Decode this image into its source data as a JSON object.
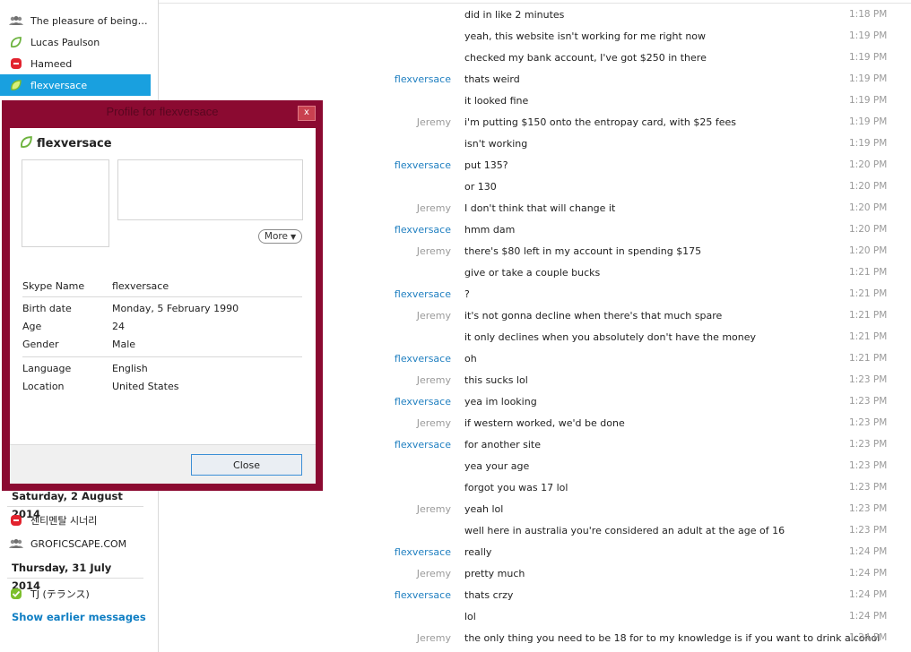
{
  "sidebar": {
    "contacts_top": [
      {
        "label": "The pleasure of being cu...",
        "icon": "group-icon"
      },
      {
        "label": "Lucas Paulson",
        "icon": "status-away-leaf-icon"
      },
      {
        "label": "Hameed",
        "icon": "status-offline-skype-icon"
      },
      {
        "label": "flexversace",
        "icon": "status-away-leaf-icon",
        "selected": true
      }
    ],
    "date_1": "Saturday, 2 August 2014",
    "contacts_mid": [
      {
        "label": "센티멘탈 시너리",
        "icon": "status-offline-skype-icon"
      },
      {
        "label": "GROFICSCAPE.COM",
        "icon": "group-icon"
      }
    ],
    "date_2": "Thursday, 31 July 2014",
    "contacts_bottom": [
      {
        "label": "TJ (テランス)",
        "icon": "status-online-check-icon"
      }
    ],
    "show_earlier": "Show earlier messages"
  },
  "dialog": {
    "title": "Profile for flexversace",
    "close_x": "x",
    "name": "flexversace",
    "more": "More",
    "fields": {
      "skype_name_label": "Skype Name",
      "skype_name": "flexversace",
      "birth_label": "Birth date",
      "birth": "Monday, 5 February 1990",
      "age_label": "Age",
      "age": "24",
      "gender_label": "Gender",
      "gender": "Male",
      "language_label": "Language",
      "language": "English",
      "location_label": "Location",
      "location": "United States"
    },
    "close_button": "Close"
  },
  "messages": [
    {
      "sender": "",
      "text": "did in like 2 minutes",
      "time": "1:18 PM"
    },
    {
      "sender": "",
      "text": "yeah, this website isn't working for me right now",
      "time": "1:19 PM"
    },
    {
      "sender": "",
      "text": "checked my bank account, I've got $250 in there",
      "time": "1:19 PM"
    },
    {
      "sender": "flexversace",
      "text": "thats weird",
      "time": "1:19 PM"
    },
    {
      "sender": "",
      "text": "it looked fine",
      "time": "1:19 PM"
    },
    {
      "sender": "Jeremy",
      "text": "i'm putting $150 onto the entropay card, with $25 fees",
      "time": "1:19 PM"
    },
    {
      "sender": "",
      "text": "isn't working",
      "time": "1:19 PM"
    },
    {
      "sender": "flexversace",
      "text": "put 135?",
      "time": "1:20 PM"
    },
    {
      "sender": "",
      "text": "or 130",
      "time": "1:20 PM"
    },
    {
      "sender": "Jeremy",
      "text": "I don't think that will change it",
      "time": "1:20 PM"
    },
    {
      "sender": "flexversace",
      "text": "hmm dam",
      "time": "1:20 PM"
    },
    {
      "sender": "Jeremy",
      "text": "there's $80 left in my account in spending $175",
      "time": "1:20 PM"
    },
    {
      "sender": "",
      "text": "give or take a couple bucks",
      "time": "1:21 PM"
    },
    {
      "sender": "flexversace",
      "text": "?",
      "time": "1:21 PM"
    },
    {
      "sender": "Jeremy",
      "text": "it's not gonna decline when there's that much spare",
      "time": "1:21 PM"
    },
    {
      "sender": "",
      "text": "it only declines when you absolutely don't have the money",
      "time": "1:21 PM"
    },
    {
      "sender": "flexversace",
      "text": "oh",
      "time": "1:21 PM"
    },
    {
      "sender": "Jeremy",
      "text": "this sucks lol",
      "time": "1:23 PM"
    },
    {
      "sender": "flexversace",
      "text": "yea im looking",
      "time": "1:23 PM"
    },
    {
      "sender": "Jeremy",
      "text": "if western worked, we'd be done",
      "time": "1:23 PM"
    },
    {
      "sender": "flexversace",
      "text": "for another site",
      "time": "1:23 PM"
    },
    {
      "sender": "",
      "text": "yea your age",
      "time": "1:23 PM"
    },
    {
      "sender": "",
      "text": "forgot you was 17 lol",
      "time": "1:23 PM"
    },
    {
      "sender": "Jeremy",
      "text": "yeah lol",
      "time": "1:23 PM"
    },
    {
      "sender": "",
      "text": "well here in australia you're considered an adult at the age of 16",
      "time": "1:23 PM"
    },
    {
      "sender": "flexversace",
      "text": "really",
      "time": "1:24 PM"
    },
    {
      "sender": "Jeremy",
      "text": "pretty much",
      "time": "1:24 PM"
    },
    {
      "sender": "flexversace",
      "text": "thats crzy",
      "time": "1:24 PM"
    },
    {
      "sender": "",
      "text": "lol",
      "time": "1:24 PM"
    },
    {
      "sender": "Jeremy",
      "text": "the only thing you need to be 18 for to my knowledge is if you want to drink alcohol",
      "time": "1:24 PM"
    }
  ],
  "colors": {
    "accent": "#19a0df",
    "dialog_frame": "#8b0a31",
    "link": "#1f7fc0"
  }
}
